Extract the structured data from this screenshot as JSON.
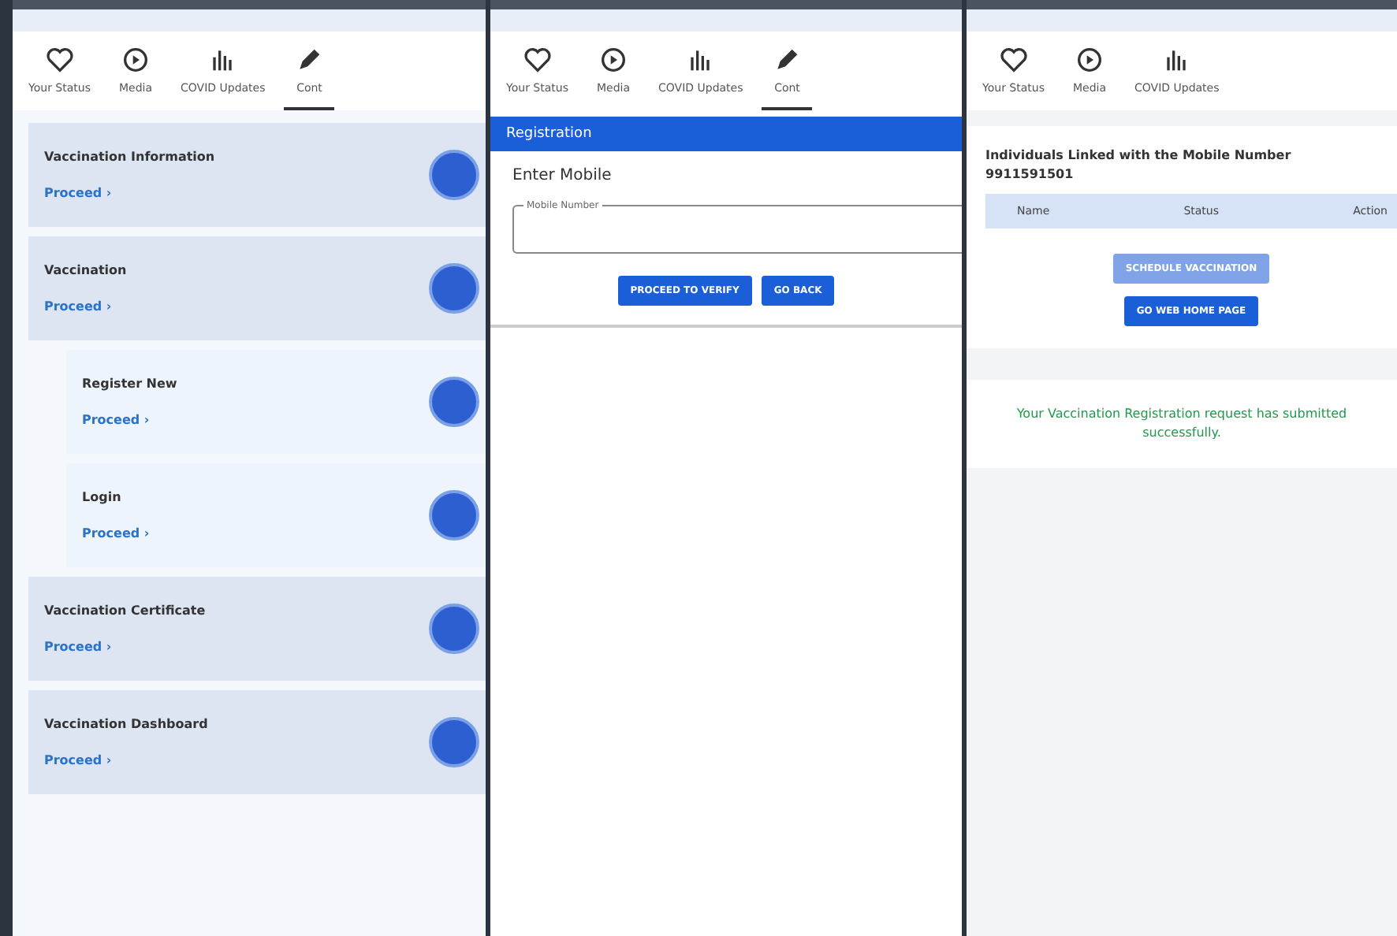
{
  "screens": [
    {
      "tabs": [
        {
          "label": "Your Status",
          "selected": false
        },
        {
          "label": "Media",
          "selected": false
        },
        {
          "label": "COVID Updates",
          "selected": false
        },
        {
          "label": "Cont",
          "selected": true
        }
      ],
      "cards": [
        {
          "kind": "main",
          "title": "Vaccination Information",
          "link": "Proceed ›"
        },
        {
          "kind": "main",
          "title": "Vaccination",
          "link": "Proceed ›"
        },
        {
          "kind": "sub",
          "title": "Register New",
          "link": "Proceed ›"
        },
        {
          "kind": "sub",
          "title": "Login",
          "link": "Proceed ›"
        },
        {
          "kind": "main",
          "title": "Vaccination Certificate",
          "link": "Proceed ›"
        },
        {
          "kind": "main",
          "title": "Vaccination Dashboard",
          "link": "Proceed ›"
        }
      ]
    },
    {
      "tabs": [
        {
          "label": "Your Status",
          "selected": false
        },
        {
          "label": "Media",
          "selected": false
        },
        {
          "label": "COVID Updates",
          "selected": false
        },
        {
          "label": "Cont",
          "selected": true
        }
      ],
      "header": "Registration",
      "prompt": "Enter Mobile",
      "field": {
        "label": "Mobile Number"
      },
      "buttons": [
        "PROCEED TO VERIFY",
        "GO BACK"
      ]
    },
    {
      "tabs": [
        {
          "label": "Your Status",
          "selected": false
        },
        {
          "label": "Media",
          "selected": false
        },
        {
          "label": "COVID Updates",
          "selected": false
        }
      ],
      "heading": "Individuals Linked with the Mobile Number",
      "number": "9911591501",
      "table": {
        "columns": [
          "Name",
          "Status",
          "Action"
        ]
      },
      "buttons": [
        {
          "label": "SCHEDULE VACCINATION",
          "disabled": true
        },
        {
          "label": "GO WEB HOME PAGE",
          "disabled": false
        }
      ],
      "message": "Your Vaccination Registration request has submitted successfully."
    }
  ]
}
